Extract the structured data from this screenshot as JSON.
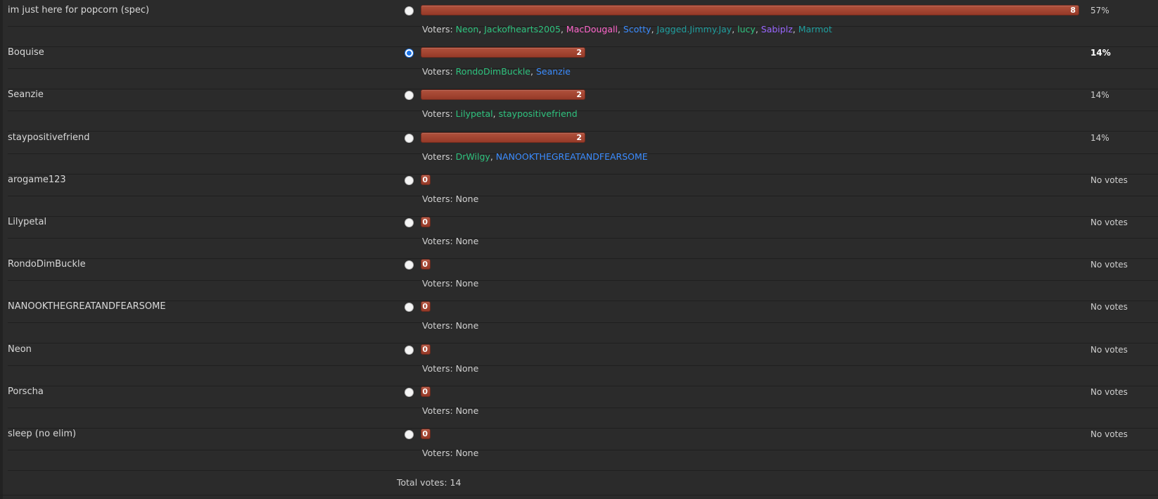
{
  "poll": {
    "options": [
      {
        "name": "im just here for popcorn (spec)",
        "votes": 8,
        "fraction": 1.0,
        "percent_label": "57%",
        "selected": false,
        "highlight_pct": false,
        "voters_label": "Voters:",
        "voters": [
          {
            "name": "Neon",
            "color": "#2ec27e"
          },
          {
            "name": "Jackofhearts2005",
            "color": "#2ec27e"
          },
          {
            "name": "MacDougall",
            "color": "#ff66cc"
          },
          {
            "name": "Scotty",
            "color": "#3b8cff"
          },
          {
            "name": "Jagged.Jimmy.Jay",
            "color": "#1f9e9e"
          },
          {
            "name": "lucy",
            "color": "#2ec27e"
          },
          {
            "name": "Sabiplz",
            "color": "#9966ff"
          },
          {
            "name": "Marmot",
            "color": "#1f9e9e"
          }
        ]
      },
      {
        "name": "Boquise",
        "votes": 2,
        "fraction": 0.25,
        "percent_label": "14%",
        "selected": true,
        "highlight_pct": true,
        "voters_label": "Voters:",
        "voters": [
          {
            "name": "RondoDimBuckle",
            "color": "#2ec27e"
          },
          {
            "name": "Seanzie",
            "color": "#3b8cff"
          }
        ]
      },
      {
        "name": "Seanzie",
        "votes": 2,
        "fraction": 0.25,
        "percent_label": "14%",
        "selected": false,
        "highlight_pct": false,
        "voters_label": "Voters:",
        "voters": [
          {
            "name": "Lilypetal",
            "color": "#2ec27e"
          },
          {
            "name": "staypositivefriend",
            "color": "#2ec27e"
          }
        ]
      },
      {
        "name": "staypositivefriend",
        "votes": 2,
        "fraction": 0.25,
        "percent_label": "14%",
        "selected": false,
        "highlight_pct": false,
        "voters_label": "Voters:",
        "voters": [
          {
            "name": "DrWilgy",
            "color": "#2ec27e"
          },
          {
            "name": "NANOOKTHEGREATANDFEARSOME",
            "color": "#3b8cff"
          }
        ]
      },
      {
        "name": "arogame123",
        "votes": 0,
        "fraction": 0,
        "percent_label": "No votes",
        "selected": false,
        "highlight_pct": false,
        "voters_label": "Voters: None",
        "voters": []
      },
      {
        "name": "Lilypetal",
        "votes": 0,
        "fraction": 0,
        "percent_label": "No votes",
        "selected": false,
        "highlight_pct": false,
        "voters_label": "Voters: None",
        "voters": []
      },
      {
        "name": "RondoDimBuckle",
        "votes": 0,
        "fraction": 0,
        "percent_label": "No votes",
        "selected": false,
        "highlight_pct": false,
        "voters_label": "Voters: None",
        "voters": []
      },
      {
        "name": "NANOOKTHEGREATANDFEARSOME",
        "votes": 0,
        "fraction": 0,
        "percent_label": "No votes",
        "selected": false,
        "highlight_pct": false,
        "voters_label": "Voters: None",
        "voters": []
      },
      {
        "name": "Neon",
        "votes": 0,
        "fraction": 0,
        "percent_label": "No votes",
        "selected": false,
        "highlight_pct": false,
        "voters_label": "Voters: None",
        "voters": []
      },
      {
        "name": "Porscha",
        "votes": 0,
        "fraction": 0,
        "percent_label": "No votes",
        "selected": false,
        "highlight_pct": false,
        "voters_label": "Voters: None",
        "voters": []
      },
      {
        "name": "sleep (no elim)",
        "votes": 0,
        "fraction": 0,
        "percent_label": "No votes",
        "selected": false,
        "highlight_pct": false,
        "voters_label": "Voters: None",
        "voters": []
      }
    ],
    "total_label": "Total votes: 14",
    "bar_color": "#a5452f"
  }
}
